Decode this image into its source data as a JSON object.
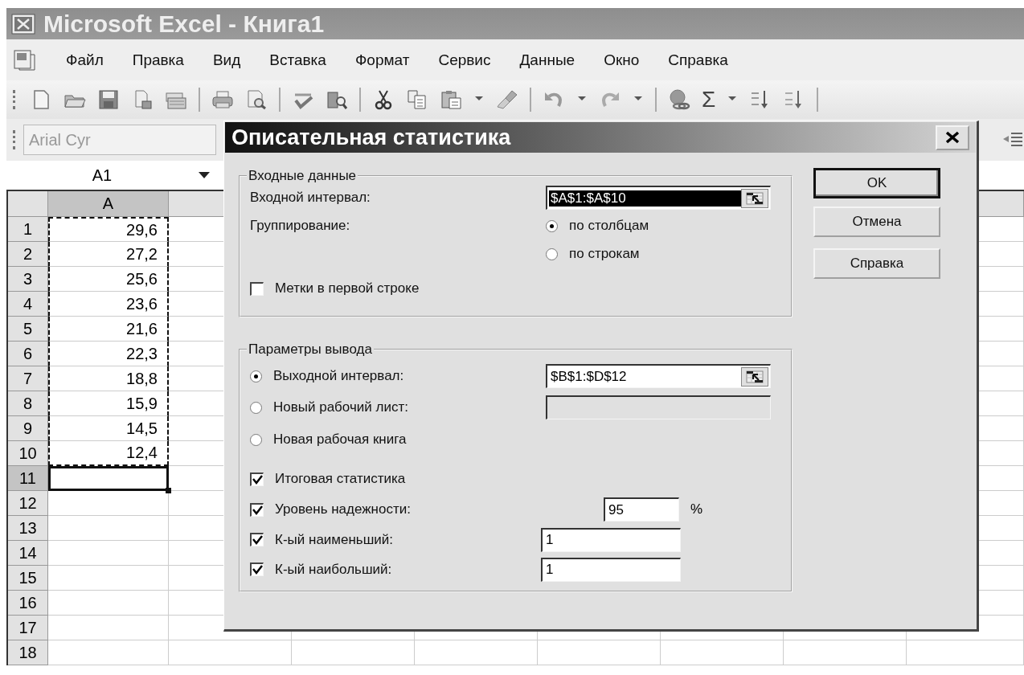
{
  "window": {
    "title": "Microsoft Excel - Книга1"
  },
  "menu": [
    "Файл",
    "Правка",
    "Вид",
    "Вставка",
    "Формат",
    "Сервис",
    "Данные",
    "Окно",
    "Справка"
  ],
  "toolbar": [
    {
      "kind": "new"
    },
    {
      "kind": "open"
    },
    {
      "kind": "save"
    },
    {
      "kind": "permission"
    },
    {
      "kind": "mail"
    },
    {
      "kind": "sep"
    },
    {
      "kind": "print"
    },
    {
      "kind": "preview"
    },
    {
      "kind": "sep"
    },
    {
      "kind": "spell"
    },
    {
      "kind": "research"
    },
    {
      "kind": "sep"
    },
    {
      "kind": "cut"
    },
    {
      "kind": "copy"
    },
    {
      "kind": "paste"
    },
    {
      "kind": "caret"
    },
    {
      "kind": "brush"
    },
    {
      "kind": "sep"
    },
    {
      "kind": "undo"
    },
    {
      "kind": "caret"
    },
    {
      "kind": "redo"
    },
    {
      "kind": "caret"
    },
    {
      "kind": "sep"
    },
    {
      "kind": "hyperlink"
    },
    {
      "kind": "sum",
      "glyph": "Σ"
    },
    {
      "kind": "caret"
    },
    {
      "kind": "sort-asc"
    },
    {
      "kind": "sort-desc"
    },
    {
      "kind": "sep"
    }
  ],
  "font_box": {
    "value": "Arial Cyr"
  },
  "name_box": {
    "value": "A1"
  },
  "columns": [
    {
      "label": "A",
      "selected": true
    }
  ],
  "rows": [
    {
      "header": "1",
      "value": "29,6",
      "in_range": true,
      "selected": false
    },
    {
      "header": "2",
      "value": "27,2",
      "in_range": true,
      "selected": false
    },
    {
      "header": "3",
      "value": "25,6",
      "in_range": true,
      "selected": false
    },
    {
      "header": "4",
      "value": "23,6",
      "in_range": true,
      "selected": false
    },
    {
      "header": "5",
      "value": "21,6",
      "in_range": true,
      "selected": false
    },
    {
      "header": "6",
      "value": "22,3",
      "in_range": true,
      "selected": false
    },
    {
      "header": "7",
      "value": "18,8",
      "in_range": true,
      "selected": false
    },
    {
      "header": "8",
      "value": "15,9",
      "in_range": true,
      "selected": false
    },
    {
      "header": "9",
      "value": "14,5",
      "in_range": true,
      "selected": false
    },
    {
      "header": "10",
      "value": "12,4",
      "in_range": true,
      "selected": false
    },
    {
      "header": "11",
      "in_range": false,
      "selected": true
    },
    {
      "header": "12",
      "in_range": false,
      "selected": false
    },
    {
      "header": "13",
      "in_range": false,
      "selected": false
    },
    {
      "header": "14",
      "in_range": false,
      "selected": false
    },
    {
      "header": "15",
      "in_range": false,
      "selected": false
    },
    {
      "header": "16",
      "in_range": false,
      "selected": false
    },
    {
      "header": "17",
      "in_range": false,
      "selected": false
    },
    {
      "header": "18",
      "in_range": false,
      "selected": false
    }
  ],
  "dialog": {
    "title": "Описательная статистика",
    "input_group": {
      "legend": "Входные данные",
      "range_label": "Входной интервал:",
      "range_value": "$A$1:$A$10",
      "grouping_label": "Группирование:",
      "grouping_options": [
        {
          "label": "по столбцам",
          "selected": true
        },
        {
          "label": "по строкам",
          "selected": false
        }
      ],
      "labels_checkbox": {
        "label": "Метки в первой строке",
        "checked": false
      }
    },
    "output_group": {
      "legend": "Параметры вывода",
      "options": [
        {
          "label": "Выходной интервал:",
          "selected": true,
          "kind": "range",
          "value": "$B$1:$D$12"
        },
        {
          "label": "Новый рабочий лист:",
          "selected": false,
          "kind": "blank"
        },
        {
          "label": "Новая рабочая книга",
          "selected": false,
          "kind": "none"
        }
      ],
      "checks": [
        {
          "label": "Итоговая статистика",
          "checked": true,
          "kind": "plain"
        },
        {
          "label": "Уровень надежности:",
          "checked": true,
          "kind": "percent",
          "value": "95",
          "unit": "%"
        },
        {
          "label": "К-ый наименьший:",
          "checked": true,
          "kind": "count",
          "value": "1"
        },
        {
          "label": "К-ый наибольший:",
          "checked": true,
          "kind": "count",
          "value": "1"
        }
      ]
    },
    "buttons": [
      {
        "label": "OK",
        "default": true
      },
      {
        "label": "Отмена",
        "default": false
      },
      {
        "label": "Справка",
        "default": false
      }
    ]
  }
}
